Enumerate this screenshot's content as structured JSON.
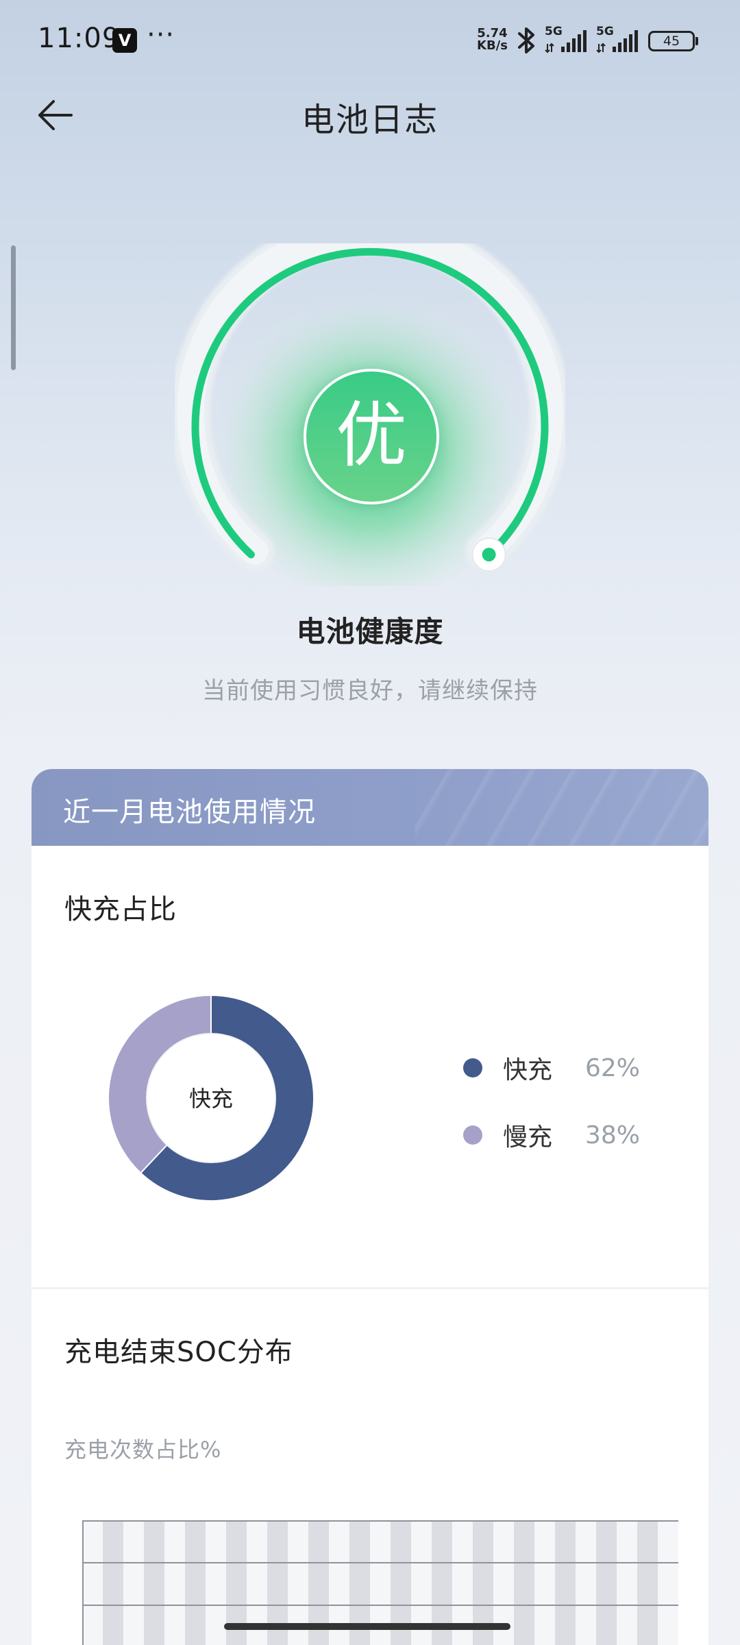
{
  "status_bar": {
    "time": "11:09",
    "app_icon_letter": "V",
    "more": "···",
    "net_speed_value": "5.74",
    "net_speed_unit": "KB/s",
    "sim1_label": "5G",
    "sim2_label": "5G",
    "battery_level": "45"
  },
  "header": {
    "title": "电池日志",
    "back_icon": "arrow-left-icon"
  },
  "health": {
    "grade": "优",
    "label": "电池健康度",
    "description": "当前使用习惯良好，请继续保持",
    "accent_color": "#1ecb7e"
  },
  "usage_card": {
    "title": "近一月电池使用情况",
    "fast_charge": {
      "title": "快充占比",
      "center_label": "快充",
      "items": [
        {
          "label": "快充",
          "value": "62%",
          "color": "#425a8c"
        },
        {
          "label": "慢充",
          "value": "38%",
          "color": "#a5a1c8"
        }
      ]
    },
    "soc": {
      "title": "充电结束SOC分布",
      "y_label": "充电次数占比%"
    }
  }
}
